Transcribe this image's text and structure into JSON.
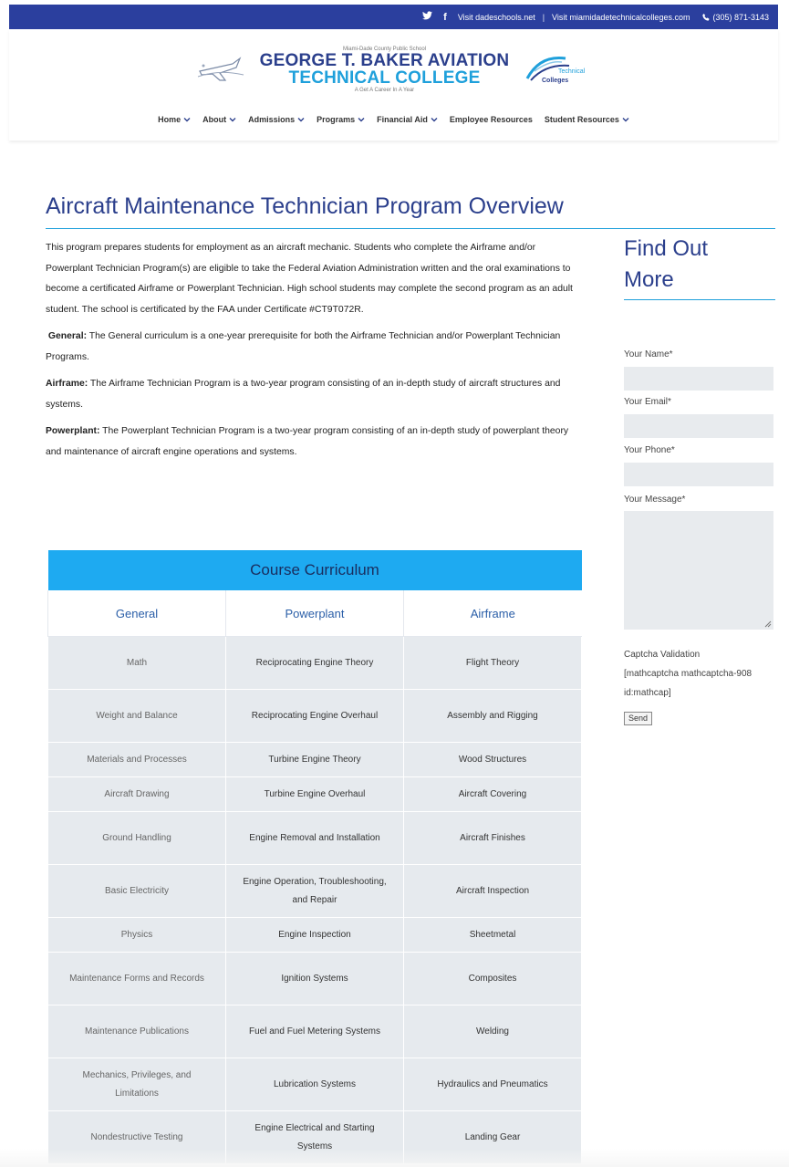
{
  "topbar": {
    "twitter_icon": "twitter-icon",
    "twitter_glyph": "🐦",
    "facebook_glyph": "f",
    "link1": "Visit dadeschools.net",
    "separator": "|",
    "link2": "Visit miamidadetechnicalcolleges.com",
    "phone": "(305) 871-3143",
    "bg_color": "#2b3f9e"
  },
  "logo": {
    "small_text": "Miami-Dade County Public School",
    "line1": "GEORGE T. BAKER AVIATION",
    "line2": "TECHNICAL COLLEGE",
    "tagline": "A Get A Career In A Year",
    "mtc_text1": "Technical",
    "mtc_text2": "Colleges"
  },
  "nav": {
    "items": [
      {
        "label": "Home"
      },
      {
        "label": "About"
      },
      {
        "label": "Admissions"
      },
      {
        "label": "Programs"
      },
      {
        "label": "Financial Aid"
      },
      {
        "label": "Employee Resources"
      },
      {
        "label": "Student Resources"
      }
    ]
  },
  "main": {
    "title": "Aircraft Maintenance Technician Program Overview",
    "intro": "This program prepares students for employment as an aircraft mechanic.  Students who complete the Airframe and/or Powerplant Technician Program(s) are eligible to take the Federal Aviation Administration written and the oral examinations to become a certificated Airframe or Powerplant Technician.  High school students may complete the second program as an adult student.  The school is certificated by the FAA under Certificate #CT9T072R.",
    "general_label": "General:",
    "general_text": " The General curriculum is a one-year prerequisite for both the Airframe Technician and/or Powerplant Technician Programs.",
    "airframe_label": "Airframe:",
    "airframe_text": " The Airframe Technician Program is a two-year program consisting of an in-depth study of aircraft structures and systems.",
    "powerplant_label": "Powerplant:",
    "powerplant_text": " The Powerplant Technician Program is a two-year program consisting of an in-depth study of powerplant theory and maintenance of aircraft engine operations and systems."
  },
  "curriculum": {
    "title": "Course Curriculum",
    "columns": [
      "General",
      "Powerplant",
      "Airframe"
    ],
    "rows": [
      [
        "Math",
        "Reciprocating Engine Theory",
        "Flight Theory"
      ],
      [
        "Weight and Balance",
        "Reciprocating Engine Overhaul",
        "Assembly and Rigging"
      ],
      [
        "Materials and Processes",
        "Turbine Engine Theory",
        "Wood Structures"
      ],
      [
        "Aircraft Drawing",
        "Turbine Engine Overhaul",
        "Aircraft Covering"
      ],
      [
        "Ground Handling",
        "Engine Removal and Installation",
        "Aircraft Finishes"
      ],
      [
        "Basic Electricity",
        "Engine Operation, Troubleshooting, and Repair",
        "Aircraft Inspection"
      ],
      [
        "Physics",
        "Engine Inspection",
        "Sheetmetal"
      ],
      [
        "Maintenance Forms and Records",
        "Ignition Systems",
        "Composites"
      ],
      [
        "Maintenance Publications",
        "Fuel and Fuel Metering Systems",
        "Welding"
      ],
      [
        "Mechanics, Privileges, and Limitations",
        "Lubrication Systems",
        "Hydraulics and Pneumatics"
      ],
      [
        "Nondestructive Testing",
        "Engine Electrical and Starting Systems",
        "Landing Gear"
      ]
    ],
    "header_color": "#1eaaf1"
  },
  "sidebar": {
    "title_line1": "Find Out",
    "title_line2": "More",
    "name_label": "Your Name*",
    "email_label": "Your Email*",
    "phone_label": "Your Phone*",
    "message_label": "Your Message*",
    "captcha_label": "Captcha Validation",
    "captcha_shortcode": "[mathcaptcha mathcaptcha-908 id:mathcap]",
    "send_label": "Send"
  },
  "colors": {
    "brand_navy": "#2b3f8c",
    "accent_blue": "#1fa0db"
  }
}
